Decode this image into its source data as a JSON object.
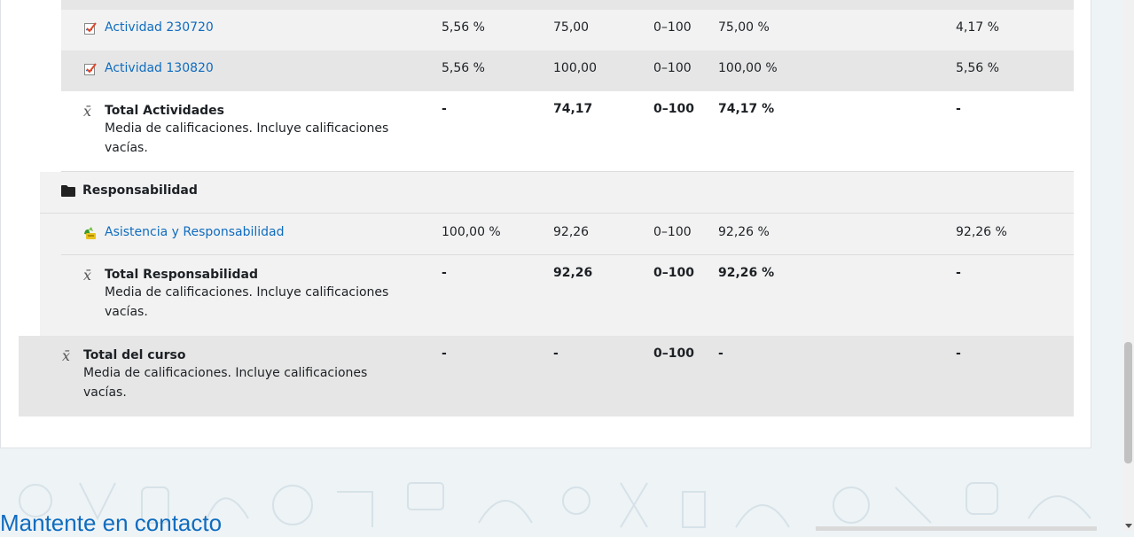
{
  "rows": [
    {
      "id": "a230720",
      "kind": "item",
      "icon": "assignment-icon",
      "name": "Actividad 230720",
      "link": true,
      "weight": "5,56 %",
      "grade": "75,00",
      "range": "0–100",
      "percentage": "75,00 %",
      "contribution": "4,17 %"
    },
    {
      "id": "a130820",
      "kind": "item",
      "icon": "assignment-icon",
      "name": "Actividad 130820",
      "link": true,
      "weight": "5,56 %",
      "grade": "100,00",
      "range": "0–100",
      "percentage": "100,00 %",
      "contribution": "5,56 %"
    },
    {
      "id": "tact",
      "kind": "total",
      "icon": "mean-icon",
      "name": "Total Actividades",
      "desc": "Media de calificaciones. Incluye calificaciones vacías.",
      "weight": "-",
      "grade": "74,17",
      "range": "0–100",
      "percentage": "74,17 %",
      "contribution": "-"
    },
    {
      "id": "catresp",
      "kind": "category",
      "icon": "folder-icon",
      "name": "Responsabilidad"
    },
    {
      "id": "asist",
      "kind": "item",
      "icon": "attendance-icon",
      "name": "Asistencia y Responsabilidad",
      "link": true,
      "weight": "100,00 %",
      "grade": "92,26",
      "range": "0–100",
      "percentage": "92,26 %",
      "contribution": "92,26 %"
    },
    {
      "id": "tresp",
      "kind": "total",
      "icon": "mean-icon",
      "name": "Total Responsabilidad",
      "desc": "Media de calificaciones. Incluye calificaciones vacías.",
      "weight": "-",
      "grade": "92,26",
      "range": "0–100",
      "percentage": "92,26 %",
      "contribution": "-"
    },
    {
      "id": "tcurso",
      "kind": "course-total",
      "icon": "mean-icon",
      "name": "Total del curso",
      "desc": "Media de calificaciones. Incluye calificaciones vacías.",
      "weight": "-",
      "grade": "-",
      "range": "0–100",
      "percentage": "-",
      "contribution": "-"
    }
  ],
  "footer": {
    "heading": "Mantente en contacto"
  },
  "colors": {
    "link": "#0f6cbf",
    "row_light": "#f2f2f2",
    "row_dark": "#e6e6e6",
    "page_bg": "#eef3f6"
  }
}
